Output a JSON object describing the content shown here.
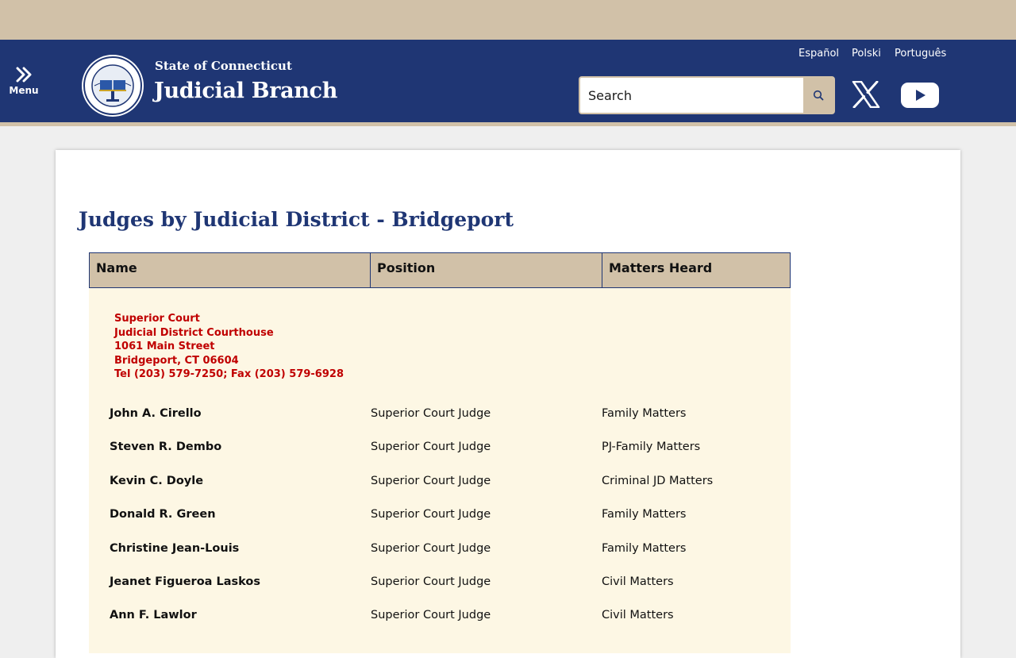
{
  "header": {
    "menu_label": "Menu",
    "brand_sub": "State of Connecticut",
    "brand_main": "Judicial Branch",
    "languages": [
      "Español",
      "Polski",
      "Português"
    ],
    "search": {
      "placeholder": "Search"
    }
  },
  "colors": {
    "navy": "#1f3674",
    "tan": "#d1c1a8",
    "court_red": "#c00000",
    "row_bg": "#fdf7e4"
  },
  "page": {
    "title": "Judges by Judicial District - Bridgeport"
  },
  "table": {
    "headers": [
      "Name",
      "Position",
      "Matters Heard"
    ],
    "court": {
      "lines": [
        "Superior Court",
        "Judicial District Courthouse",
        "1061 Main Street",
        "Bridgeport, CT 06604",
        "Tel (203) 579-7250; Fax (203) 579-6928"
      ]
    },
    "rows": [
      {
        "name": "John A. Cirello",
        "position": "Superior Court Judge",
        "matters": "Family Matters"
      },
      {
        "name": "Steven R. Dembo",
        "position": "Superior Court Judge",
        "matters": "PJ-Family Matters"
      },
      {
        "name": "Kevin C. Doyle",
        "position": "Superior Court Judge",
        "matters": "Criminal JD Matters"
      },
      {
        "name": "Donald R. Green",
        "position": "Superior Court Judge",
        "matters": "Family Matters"
      },
      {
        "name": "Christine Jean-Louis",
        "position": "Superior Court Judge",
        "matters": "Family Matters"
      },
      {
        "name": "Jeanet Figueroa Laskos",
        "position": "Superior Court Judge",
        "matters": "Civil Matters"
      },
      {
        "name": "Ann F. Lawlor",
        "position": "Superior Court Judge",
        "matters": "Civil Matters"
      }
    ]
  }
}
